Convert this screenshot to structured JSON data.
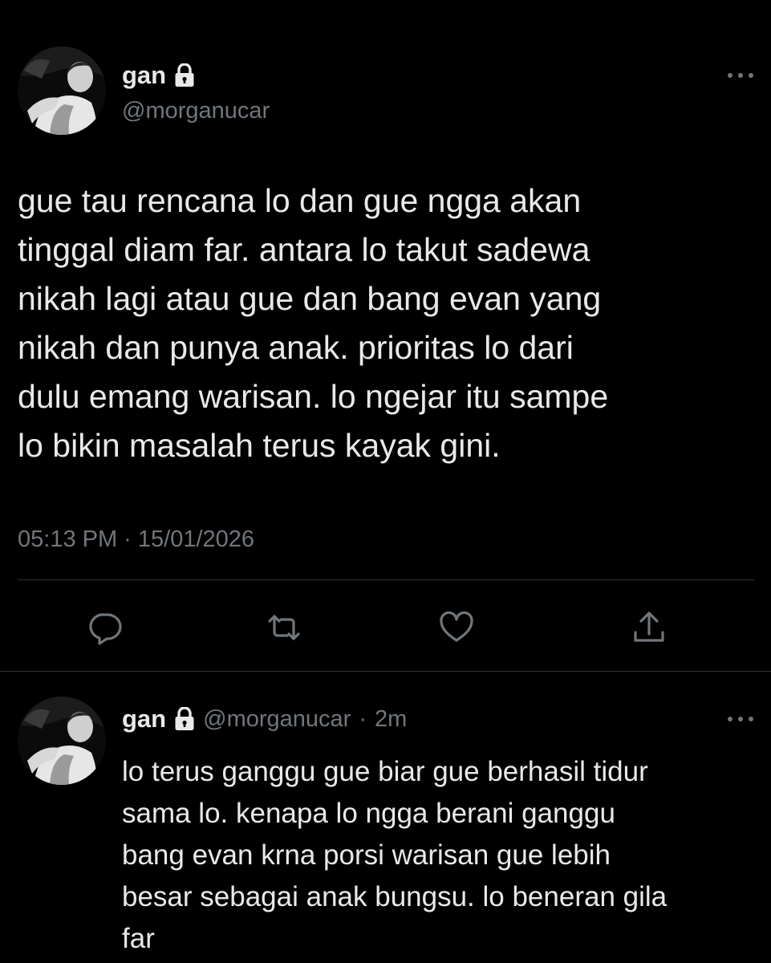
{
  "main_tweet": {
    "author_name": "gan",
    "author_handle": "@morganucar",
    "body_lines": [
      "gue tau rencana lo dan gue ngga akan",
      "tinggal diam far. antara lo takut sadewa",
      "nikah lagi atau gue dan bang evan yang",
      "nikah dan punya anak. prioritas lo dari",
      "dulu emang warisan. lo ngejar itu sampe",
      "lo bikin masalah terus kayak gini."
    ],
    "timestamp": "05:13 PM · 15/01/2026",
    "actions": [
      "reply-icon",
      "retweet-icon",
      "like-icon",
      "share-icon"
    ]
  },
  "reply_tweet": {
    "author_name": "gan",
    "author_handle": "@morganucar",
    "separator": "·",
    "time_ago": "2m",
    "body_lines": [
      "lo terus ganggu gue biar gue berhasil tidur",
      "sama lo. kenapa lo ngga berani ganggu",
      "bang evan krna porsi warisan gue lebih",
      "besar sebagai anak bungsu. lo beneran gila",
      "far"
    ]
  },
  "icons": {
    "lock": "lock-icon",
    "more": "more-icon"
  },
  "colors": {
    "background": "#000000",
    "text_primary": "#e7e9ea",
    "text_secondary": "#71767b",
    "divider": "#2f3336"
  }
}
